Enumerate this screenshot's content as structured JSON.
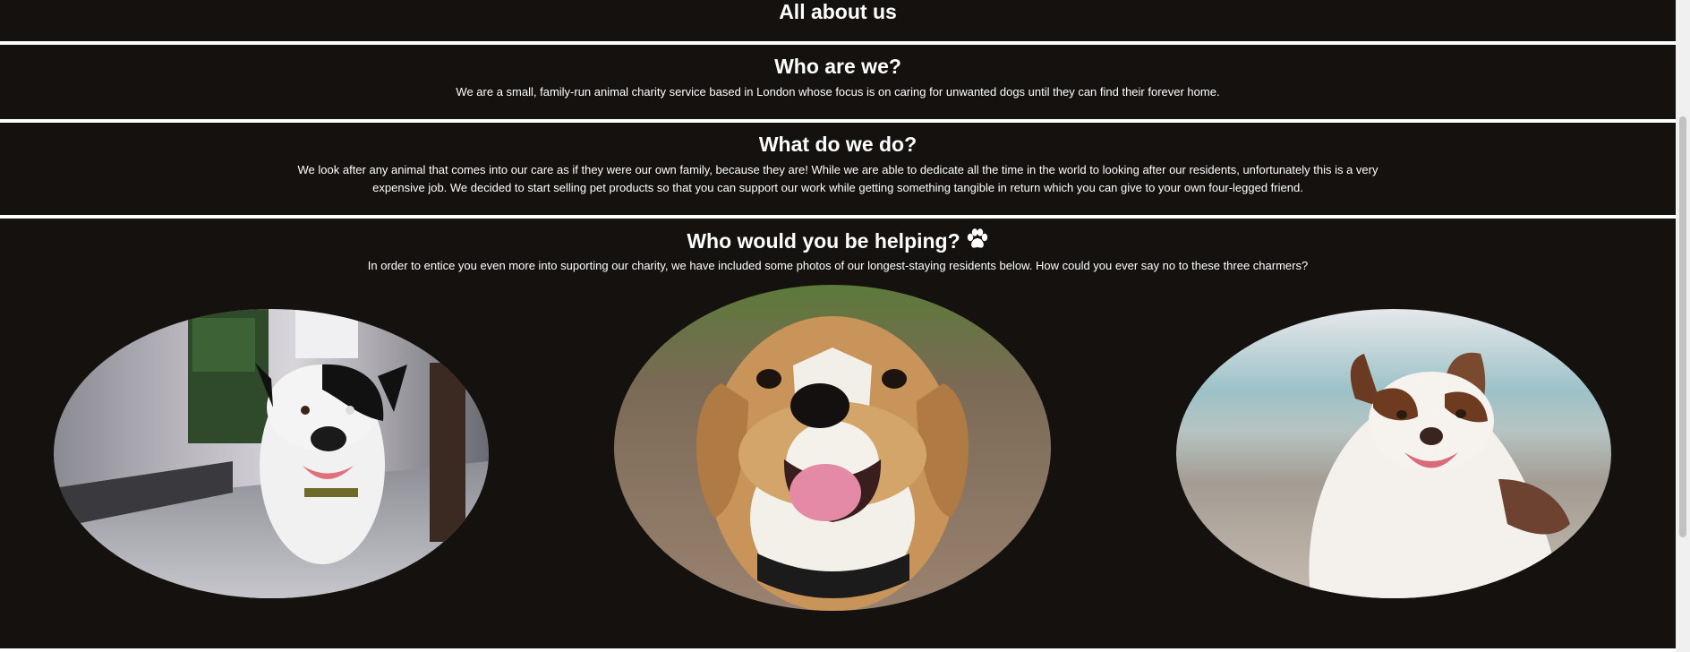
{
  "title": "All about us",
  "sections": [
    {
      "heading": "Who are we?",
      "text": "We are a small, family-run animal charity service based in London whose focus is on caring for unwanted dogs until they can find their forever home."
    },
    {
      "heading": "What do we do?",
      "text": "We look after any animal that comes into our care as if they were our own family, because they are! While we are able to dedicate all the time in the world to looking after our residents, unfortunately this is a very expensive job. We decided to start selling pet products so that you can support our work while getting something tangible in return which you can give to your own four-legged friend."
    },
    {
      "heading": "Who would you be helping?",
      "icon": "paw-icon",
      "text": "In order to entice you even more into suporting our charity, we have included some photos of our longest-staying residents below. How could you ever say no to these three charmers?"
    }
  ],
  "photos": [
    {
      "subject": "black-and-white dog on a street"
    },
    {
      "subject": "beagle smiling"
    },
    {
      "subject": "brown-and-white collie on a beach"
    }
  ],
  "colors": {
    "background": "#14110f",
    "text": "#ffffff",
    "divider": "#ffffff"
  }
}
